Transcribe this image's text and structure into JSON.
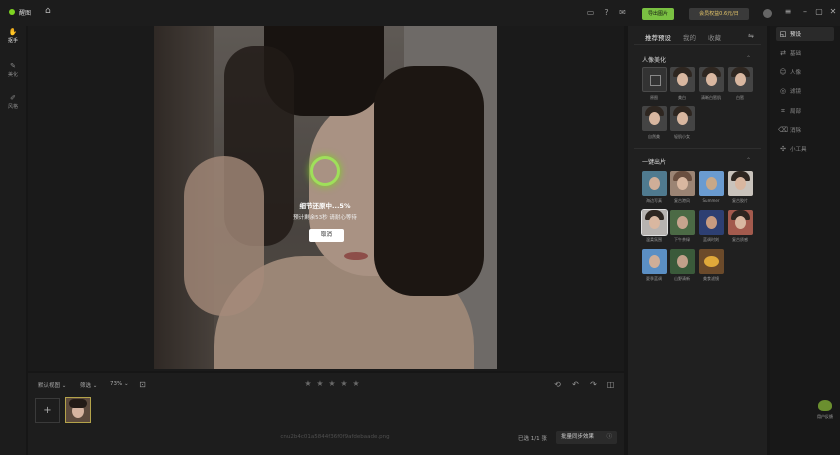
{
  "app": {
    "name": "醒图"
  },
  "topbar": {
    "export_label": "导出图片",
    "vip_label": "会员权益0.6元/日"
  },
  "left_rail": [
    {
      "label": "抠手",
      "active": true
    },
    {
      "label": "美化",
      "active": false
    },
    {
      "label": "风格",
      "active": false
    }
  ],
  "progress": {
    "title": "细节还原中...5%",
    "subtitle": "预计剩余53秒 请耐心等待",
    "percent": 5,
    "cancel_label": "取消"
  },
  "bottom": {
    "view_label": "默认视图",
    "filter_label": "筛选",
    "zoom_label": "73%",
    "rating_stars": 5,
    "add_label": "+",
    "filename": "cnu2b4c01a5844f36f0f9afdebaade.png",
    "selected_count": "已选 1/1 张",
    "apply_label": "批量同步效果"
  },
  "right_panel": {
    "tabs": [
      {
        "label": "推荐预设",
        "active": true
      },
      {
        "label": "我的",
        "active": false
      },
      {
        "label": "收藏",
        "active": false
      }
    ],
    "section1": {
      "title": "人像美化",
      "items": [
        "原图",
        "美白",
        "清晰白皙肌",
        "白皙",
        "自然美",
        "轻肌小女"
      ]
    },
    "section2": {
      "title": "一键出片",
      "items": [
        "海边写真",
        "复古港风",
        "Summer",
        "复古胶片",
        "温柔氛围",
        "下午茶绿",
        "蓝调时刻",
        "复古质感",
        "夏季蓝调",
        "山野清新",
        "美食滤镜"
      ]
    }
  },
  "far_right": [
    {
      "label": "预设",
      "icon": "preset-icon",
      "active": true
    },
    {
      "label": "基础",
      "icon": "adjust-icon",
      "active": false
    },
    {
      "label": "人像",
      "icon": "portrait-icon",
      "active": false
    },
    {
      "label": "滤镜",
      "icon": "filter-icon",
      "active": false
    },
    {
      "label": "局部",
      "icon": "crop-icon",
      "active": false
    },
    {
      "label": "消除",
      "icon": "eraser-icon",
      "active": false
    },
    {
      "label": "小工具",
      "icon": "tools-icon",
      "active": false
    }
  ],
  "mascot_label": "用户反馈",
  "colors": {
    "accent": "#7ac142",
    "ring": "#9fe05a",
    "background": "#161616"
  }
}
